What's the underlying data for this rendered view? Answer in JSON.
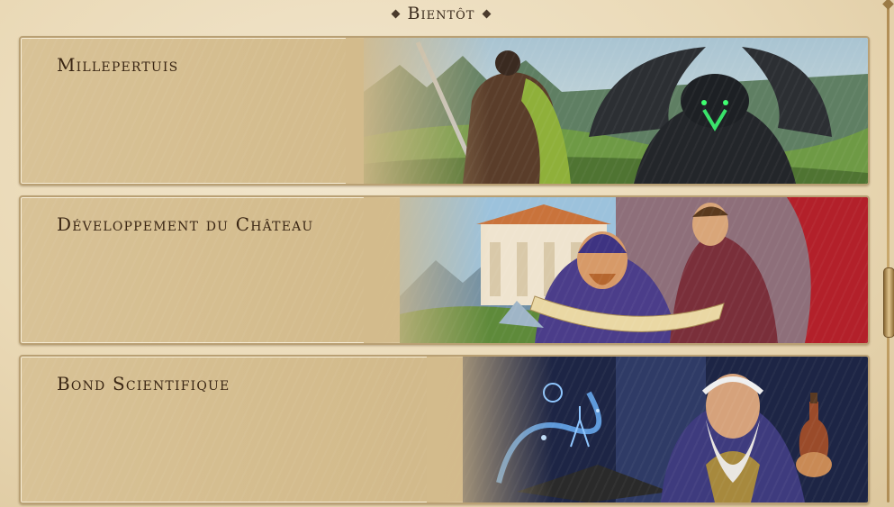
{
  "header": {
    "title": "Bientôt"
  },
  "cards": [
    {
      "title": "Millepertuis",
      "art": "knight-facing-dragon"
    },
    {
      "title": "Développement du Château",
      "art": "architects-with-blueprint"
    },
    {
      "title": "Bond Scientifique",
      "art": "wizard-with-potion"
    }
  ],
  "colors": {
    "parchment": "#d6bf92",
    "border": "#b9a074",
    "text": "#3a2614"
  }
}
